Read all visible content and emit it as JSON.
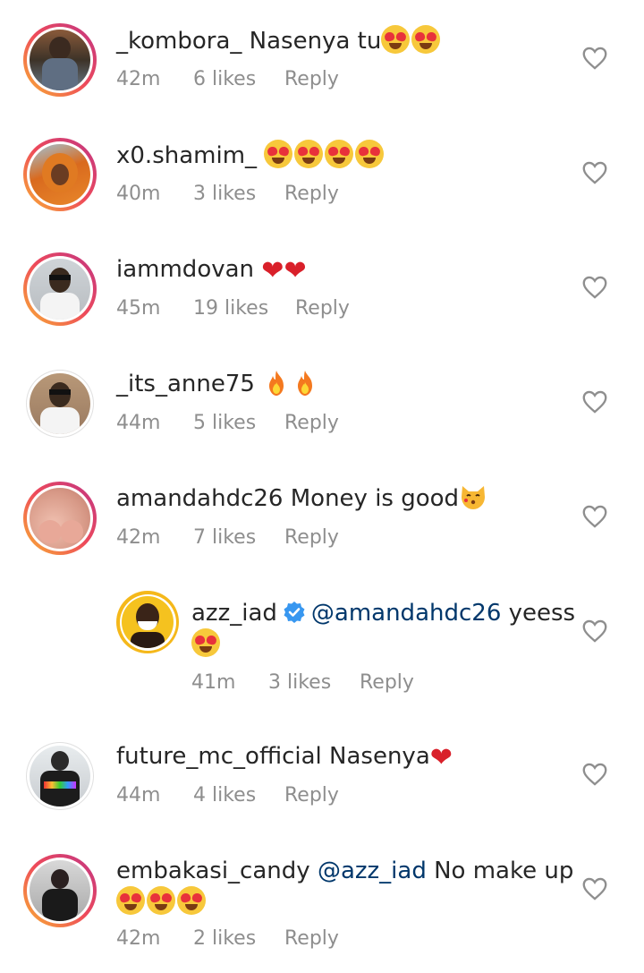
{
  "comments": [
    {
      "username": "_kombora_",
      "text": "Nasenya tu",
      "emoji_count": 2,
      "time": "42m",
      "likes": "6 likes",
      "reply": "Reply"
    },
    {
      "username": "x0.shamim_",
      "text": "",
      "emoji_count": 4,
      "time": "40m",
      "likes": "3 likes",
      "reply": "Reply"
    },
    {
      "username": "iammdovan",
      "text": "",
      "hearts": 2,
      "time": "45m",
      "likes": "19 likes",
      "reply": "Reply"
    },
    {
      "username": "_its_anne75",
      "text": "",
      "fires": 2,
      "time": "44m",
      "likes": "5 likes",
      "reply": "Reply"
    },
    {
      "username": "amandahdc26",
      "text": "Money is good",
      "time": "42m",
      "likes": "7 likes",
      "reply": "Reply"
    },
    {
      "username": "azz_iad",
      "mention": "@amandahdc26",
      "text": "yeess",
      "emoji_count": 1,
      "time": "41m",
      "likes": "3 likes",
      "reply": "Reply"
    },
    {
      "username": "future_mc_official",
      "text": "Nasenya",
      "time": "44m",
      "likes": "4 likes",
      "reply": "Reply"
    },
    {
      "username": "embakasi_candy",
      "mention": "@azz_iad",
      "text": "No make up",
      "emoji_count": 3,
      "time": "42m",
      "likes": "2 likes",
      "reply": "Reply"
    }
  ],
  "colors": {
    "story_ring_start": "#f9b233",
    "story_ring_end": "#c13584",
    "mention": "#00376b",
    "meta": "#8e8e8e",
    "verified": "#3897f0"
  },
  "icons": {
    "like": "heart-outline-icon",
    "verified": "verified-badge-icon"
  }
}
